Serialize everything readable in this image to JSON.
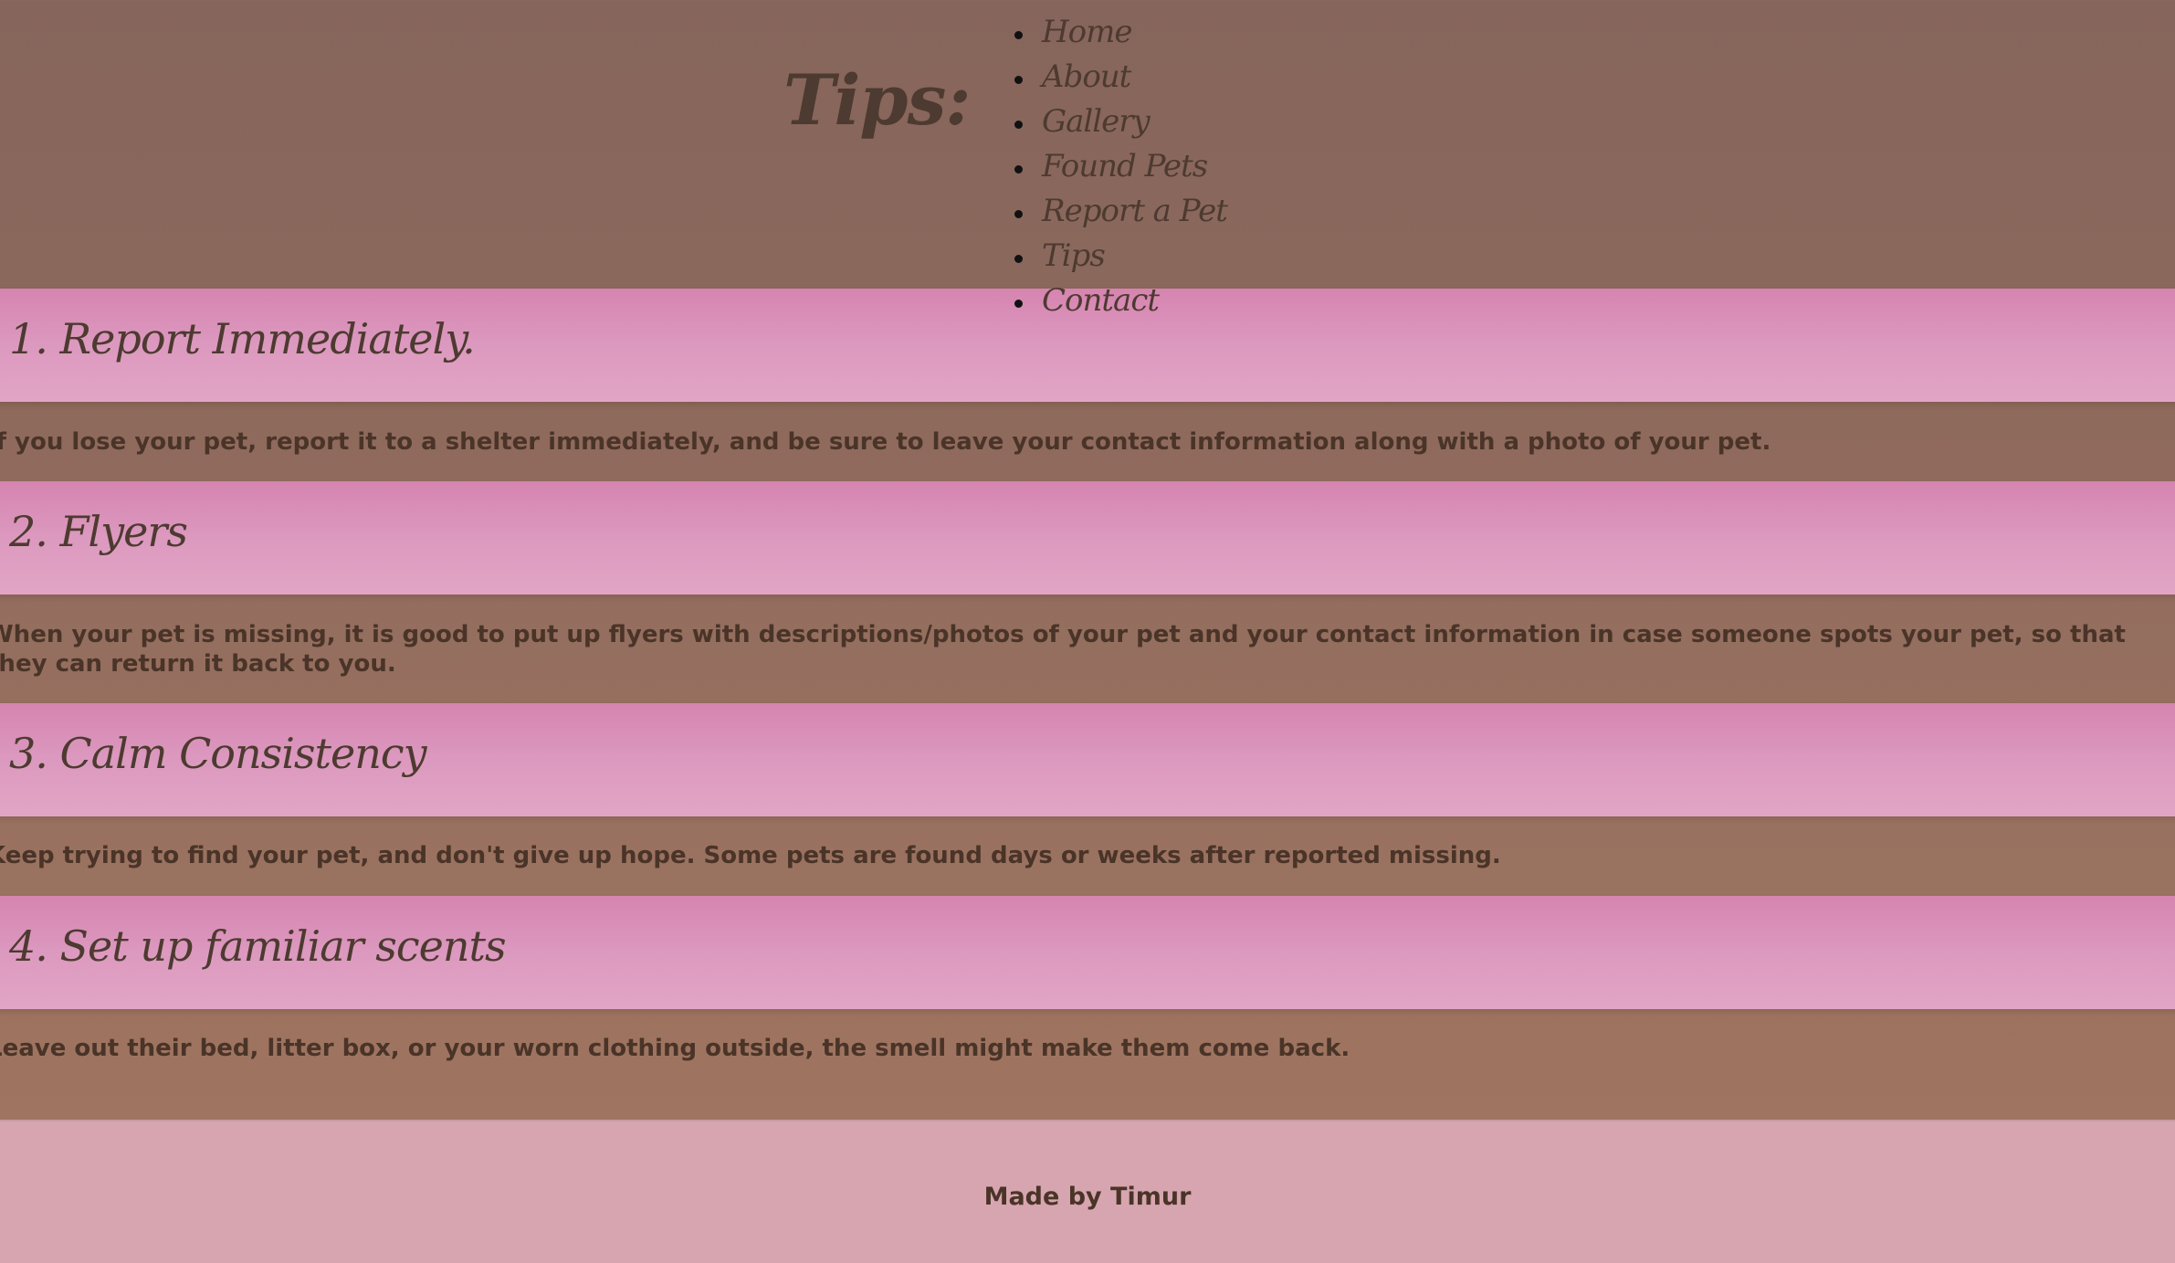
{
  "header": {
    "title": "Tips:"
  },
  "nav": {
    "items": [
      {
        "label": "Home"
      },
      {
        "label": "About"
      },
      {
        "label": "Gallery"
      },
      {
        "label": "Found Pets"
      },
      {
        "label": "Report a Pet"
      },
      {
        "label": "Tips"
      },
      {
        "label": "Contact"
      }
    ]
  },
  "tips": [
    {
      "heading": "1. Report Immediately.",
      "body": "If you lose your pet, report it to a shelter immediately, and be sure to leave your contact information along with a photo of your pet."
    },
    {
      "heading": "2. Flyers",
      "body": "When your pet is missing, it is good to put up flyers with descriptions/photos of your pet and your contact information in case someone spots your pet, so that they can return it back to you."
    },
    {
      "heading": "3. Calm Consistency",
      "body": "Keep trying to find your pet, and don't give up hope. Some pets are found days or weeks after reported missing."
    },
    {
      "heading": "4. Set up familiar scents",
      "body": "Leave out their bed, litter box, or your worn clothing outside, the smell might make them come back."
    }
  ],
  "footer": {
    "text": "Made by Timur"
  },
  "colors": {
    "background": "#8d695c",
    "tip_header": "#dc99bf",
    "footer": "#d7a5b0",
    "text": "#4a3428"
  }
}
